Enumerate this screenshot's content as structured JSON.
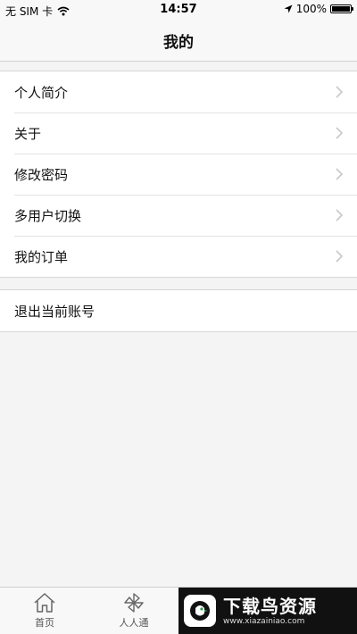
{
  "status_bar": {
    "carrier": "无 SIM 卡",
    "time": "14:57",
    "battery": "100%",
    "battery_level": 1.0,
    "icons": [
      "wifi-icon",
      "location-arrow-icon",
      "battery-icon"
    ]
  },
  "nav": {
    "title": "我的"
  },
  "menu": {
    "items": [
      {
        "label": "个人简介"
      },
      {
        "label": "关于"
      },
      {
        "label": "修改密码"
      },
      {
        "label": "多用户切换"
      },
      {
        "label": "我的订单"
      }
    ]
  },
  "logout": {
    "label": "退出当前账号"
  },
  "tabs": [
    {
      "label": "首页",
      "icon": "home-icon"
    },
    {
      "label": "人人通",
      "icon": "pinwheel-icon"
    }
  ],
  "watermark": {
    "title": "下载鸟资源",
    "url": "www.xiazainiao.com"
  },
  "colors": {
    "background": "#f4f4f4",
    "cell": "#ffffff",
    "chevron": "#c7c7cc"
  }
}
